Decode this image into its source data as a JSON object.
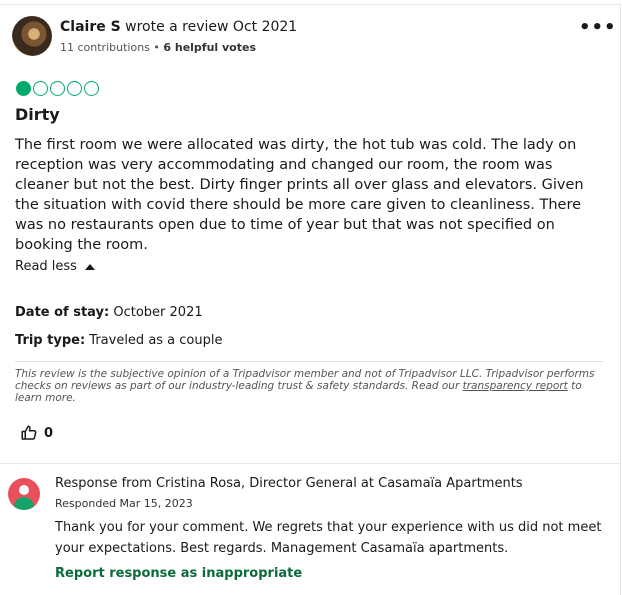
{
  "review": {
    "author": "Claire S",
    "wrote_text": " wrote a review Oct 2021",
    "contributions": "11 contributions",
    "dot": " • ",
    "helpful_votes": "6 helpful votes",
    "more_icon": "more-options-icon",
    "rating": 1,
    "rating_max": 5,
    "rating_color": "#00aa6c",
    "title": "Dirty",
    "body": "The first room we were allocated was dirty, the hot tub was cold. The lady on reception was very accommodating and changed our room, the room was cleaner but not the best. Dirty finger prints all over glass and elevators. Given the situation with covid there should be more care given to cleanliness. There was no restaurants open due to time of year but that was not specified on booking the room.",
    "read_less": "Read less",
    "date_of_stay_label": "Date of stay:",
    "date_of_stay_value": " October 2021",
    "trip_type_label": "Trip type:",
    "trip_type_value": " Traveled as a couple",
    "disclaimer_text": "This review is the subjective opinion of a Tripadvisor member and not of Tripadvisor LLC. Tripadvisor performs checks on reviews as part of our industry-leading trust & safety standards. Read our ",
    "disclaimer_link": "transparency report",
    "disclaimer_end": " to learn more.",
    "helpful_count": "0"
  },
  "response": {
    "title": "Response from Cristina Rosa, Director General at Casamaïa Apartments",
    "date": "Responded Mar 15, 2023",
    "body": "Thank you for your comment. We regrets that your experience with us did not meet your expectations. Best regards. Management Casamaïa apartments.",
    "report": "Report response as inappropriate",
    "accent_color": "#0b6b3a"
  }
}
